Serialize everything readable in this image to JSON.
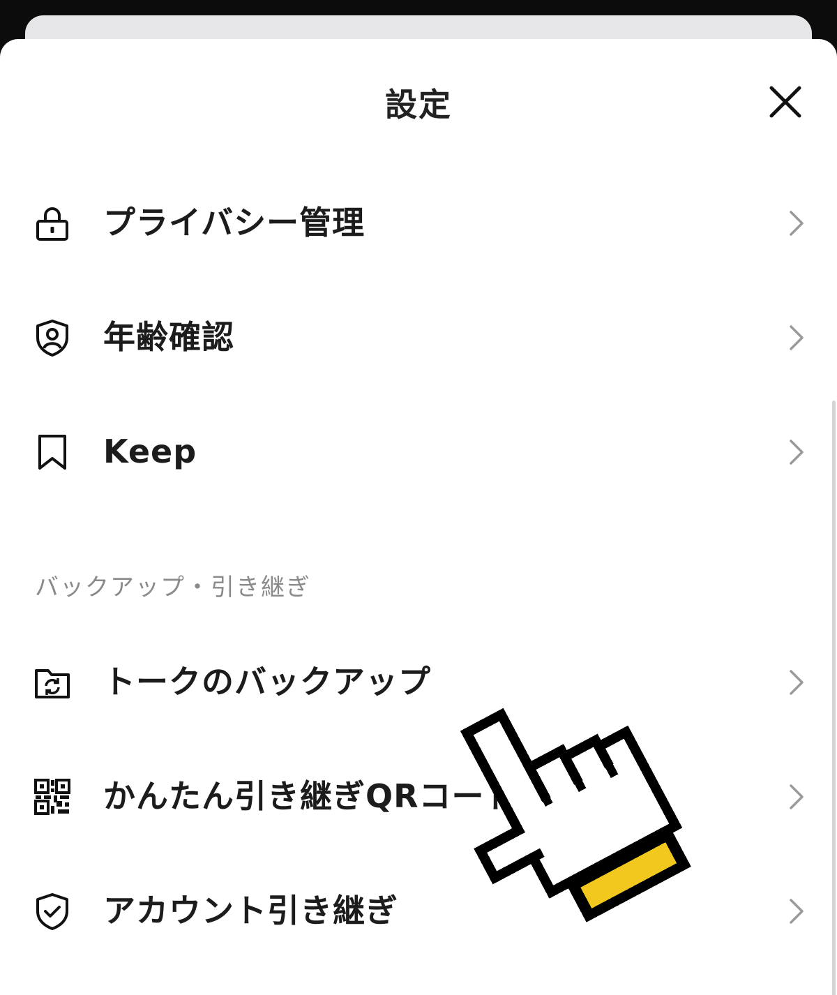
{
  "header": {
    "title": "設定",
    "close_icon": "close-icon"
  },
  "items_top": [
    {
      "label": "プライバシー管理",
      "icon": "lock-icon"
    },
    {
      "label": "年齢確認",
      "icon": "person-shield-icon"
    },
    {
      "label": "Keep",
      "icon": "bookmark-icon"
    }
  ],
  "section": {
    "title": "バックアップ・引き継ぎ"
  },
  "items_backup": [
    {
      "label": "トークのバックアップ",
      "icon": "folder-sync-icon"
    },
    {
      "label": "かんたん引き継ぎQRコード",
      "icon": "qr-code-icon"
    },
    {
      "label": "アカウント引き継ぎ",
      "icon": "shield-check-icon"
    }
  ],
  "overlay": {
    "icon": "pointing-hand-cursor-icon",
    "accent_color": "#f2c81f"
  },
  "colors": {
    "background": "#ffffff",
    "text": "#1c1c1c",
    "section_text": "#8a8a8a",
    "chevron": "#9a9a9a"
  }
}
